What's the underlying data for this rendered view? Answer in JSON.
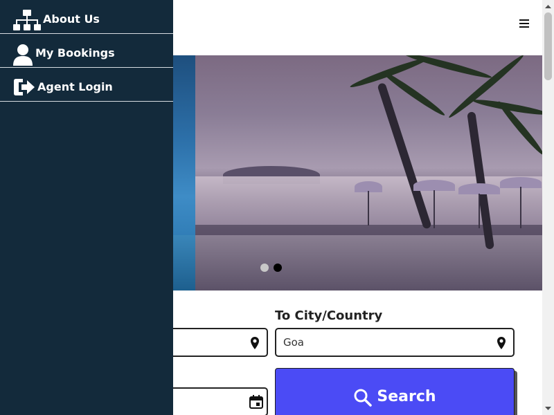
{
  "side_menu": {
    "items": [
      {
        "label": "About Us",
        "icon": "sitemap-icon"
      },
      {
        "label": "My Bookings",
        "icon": "user-icon"
      },
      {
        "label": "Agent Login",
        "icon": "sign-in-icon"
      }
    ]
  },
  "header": {
    "menu_icon": "hamburger-icon"
  },
  "carousel": {
    "slides": 2,
    "active_slide": 2
  },
  "search_form": {
    "to_label": "To City/Country",
    "from_value": "",
    "to_value": "Goa",
    "date_value": "",
    "search_label": "Search"
  },
  "colors": {
    "sidebar_bg": "#132a3b",
    "search_button_bg": "#4b4bf5",
    "text": "#222222"
  }
}
